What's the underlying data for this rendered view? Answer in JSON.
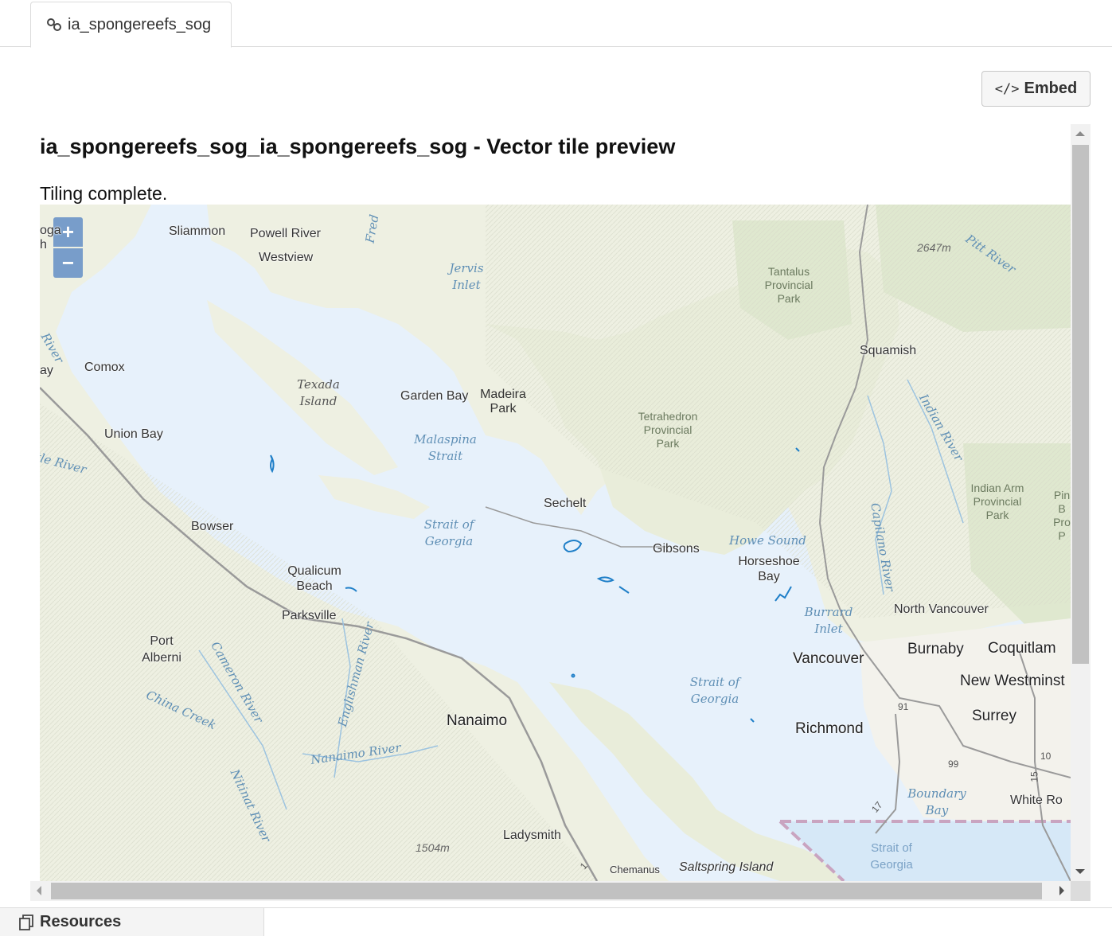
{
  "tab": {
    "label": "ia_spongereefs_sog",
    "icon": "link-icon"
  },
  "embed": {
    "label": "Embed",
    "code_glyph": "</>"
  },
  "preview": {
    "title": "ia_spongereefs_sog_ia_spongereefs_sog - Vector tile preview",
    "status": "Tiling complete."
  },
  "map": {
    "zoom_in": "+",
    "zoom_out": "−",
    "places": {
      "sliammon": "Sliammon",
      "powell_river": "Powell River",
      "westview": "Westview",
      "comox": "Comox",
      "union_bay": "Union Bay",
      "garden_bay": "Garden Bay",
      "sechelt": "Sechelt",
      "gibsons": "Gibsons",
      "bowser": "Bowser",
      "qualicum_beach": "Qualicum Beach",
      "parksville": "Parksville",
      "port_alberni": "Port Alberni",
      "nanaimo": "Nanaimo",
      "ladysmith": "Ladysmith",
      "chemainus": "Chemanus",
      "saltspring": "Saltspring Island",
      "squamish": "Squamish",
      "horseshoe_bay": "Horseshoe Bay",
      "north_vancouver": "North Vancouver",
      "vancouver": "Vancouver",
      "burnaby": "Burnaby",
      "coquitlam": "Coquitlam",
      "new_westminster": "New Westminst",
      "surrey": "Surrey",
      "richmond": "Richmond",
      "white_rock": "White Ro",
      "edge_ay": "ay",
      "edge_oga": "oga",
      "edge_h": "h"
    },
    "water": {
      "jervis_inlet": "Jervis Inlet",
      "texada_island": "Texada Island",
      "malaspina_strait": "Malaspina Strait",
      "strait_of_georgia_1": "Strait of Georgia",
      "strait_of_georgia_2": "Strait of Georgia",
      "strait_of_georgia_3": "Strait of Georgia",
      "howe_sound": "Howe Sound",
      "burrard_inlet": "Burrard Inlet",
      "boundary_bay": "Boundary Bay",
      "pitt_river": "Pitt River",
      "indian_river": "Indian River",
      "capilano_river": "Capilano River",
      "cameron_river": "Cameron River",
      "china_creek": "China Creek",
      "englishman_river": "Englishman River",
      "nanaimo_river": "Nanaimo River",
      "nitinat_river": "Nitinat River",
      "edge_river_1": "River",
      "edge_river_2": "tle River",
      "fred": "Fred"
    },
    "parks": {
      "tantalus": "Tantalus Provincial Park",
      "madeira": "Madeira Park",
      "tetrahedron": "Tetrahedron Provincial Park",
      "indian_arm": "Indian Arm Provincial Park",
      "edge_park": "Pin B Pro P"
    },
    "elevations": {
      "e1": "2647m",
      "e2": "1504m"
    },
    "roads": {
      "r91": "91",
      "r99": "99",
      "r10": "10",
      "r15": "15",
      "r17": "17",
      "r1": "1"
    },
    "colors": {
      "water": "#e7f1fb",
      "land": "#eef0e2",
      "reef": "#1f7fc8",
      "park": "#dfe8cf"
    }
  },
  "bottom_tab": {
    "label": "Resources",
    "icon": "resources-icon"
  }
}
